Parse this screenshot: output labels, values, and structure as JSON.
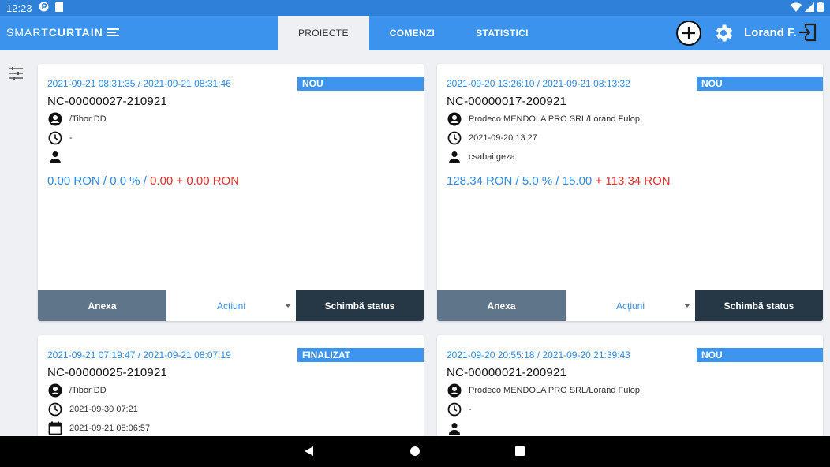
{
  "status_bar": {
    "time": "12:23"
  },
  "app": {
    "logo_thin": "SMART",
    "logo_bold": "CURTAIN",
    "tabs": [
      {
        "label": "PROIECTE",
        "active": true
      },
      {
        "label": "COMENZI",
        "active": false
      },
      {
        "label": "STATISTICI",
        "active": false
      }
    ],
    "user_name": "Lorand F."
  },
  "cards": [
    {
      "dates": "2021-09-21 08:31:35 / 2021-09-21 08:31:46",
      "badge": "NOU",
      "code": "NC-00000027-210921",
      "client": "/Tibor DD",
      "time": "-",
      "person": "",
      "totals_blue": "0.00 RON / 0.0 % / ",
      "totals_red": "0.00 + 0.00 RON",
      "anexa": "Anexa",
      "actiuni": "Acțiuni",
      "status_btn": "Schimbă status"
    },
    {
      "dates": "2021-09-20 13:26:10 / 2021-09-21 08:13:32",
      "badge": "NOU",
      "code": "NC-00000017-200921",
      "client": "Prodeco MENDOLA PRO SRL/Lorand Fulop",
      "time": "2021-09-20 13:27",
      "person": "csabai geza",
      "totals_blue": "128.34 RON / 5.0 % / 15.00",
      "totals_red": " + 113.34 RON",
      "anexa": "Anexa",
      "actiuni": "Acțiuni",
      "status_btn": "Schimbă status"
    },
    {
      "dates": "2021-09-21 07:19:47 / 2021-09-21 08:07:19",
      "badge": "FINALIZAT",
      "code": "NC-00000025-210921",
      "client": "/Tibor DD",
      "time": "2021-09-30 07:21",
      "calendar": "2021-09-21 08:06:57"
    },
    {
      "dates": "2021-09-20 20:55:18 / 2021-09-20 21:39:43",
      "badge": "NOU",
      "code": "NC-00000021-200921",
      "client": "Prodeco MENDOLA PRO SRL/Lorand Fulop",
      "time": "-",
      "person": ""
    }
  ]
}
